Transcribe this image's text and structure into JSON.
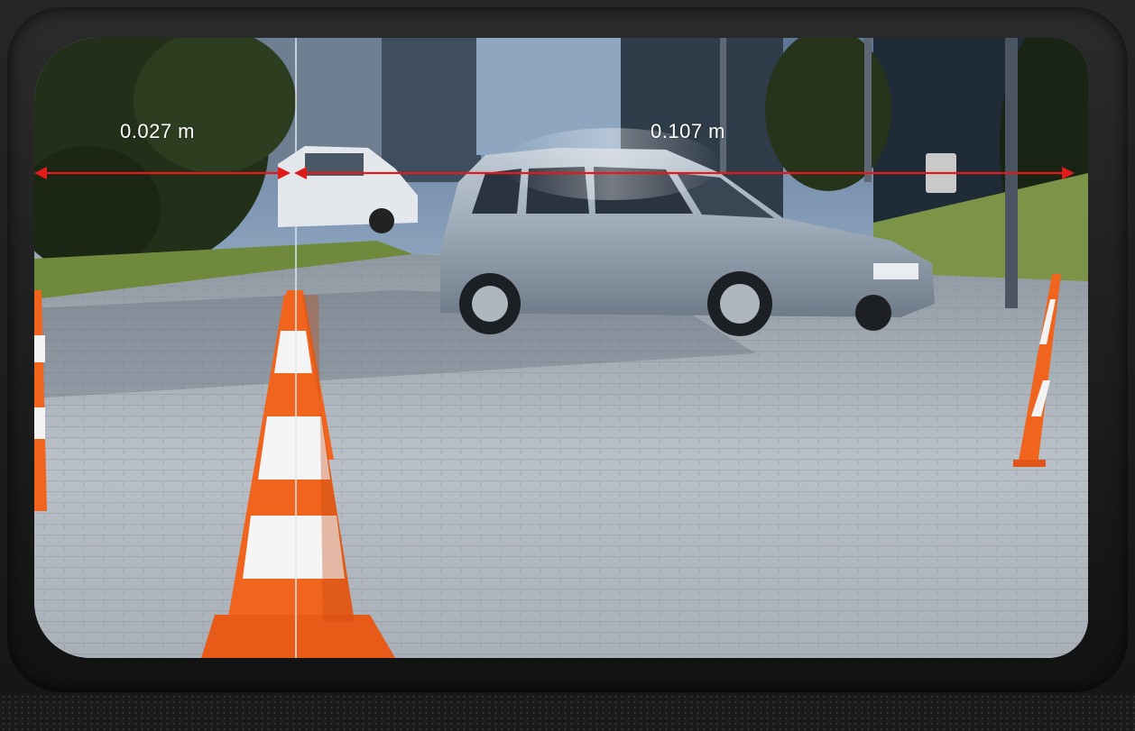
{
  "measurements": {
    "left_distance": "0.027 m",
    "right_distance": "0.107 m"
  },
  "colors": {
    "arrow": "#e11b1b",
    "cone_orange": "#f0641e",
    "car_body": "#9aa7b4",
    "pavement": "#b5bcc3",
    "grass": "#6f8a3c"
  },
  "scene": {
    "objects": [
      "traffic-cone",
      "silver-hatchback-car",
      "white-van",
      "street-lamp",
      "trees",
      "building"
    ]
  }
}
